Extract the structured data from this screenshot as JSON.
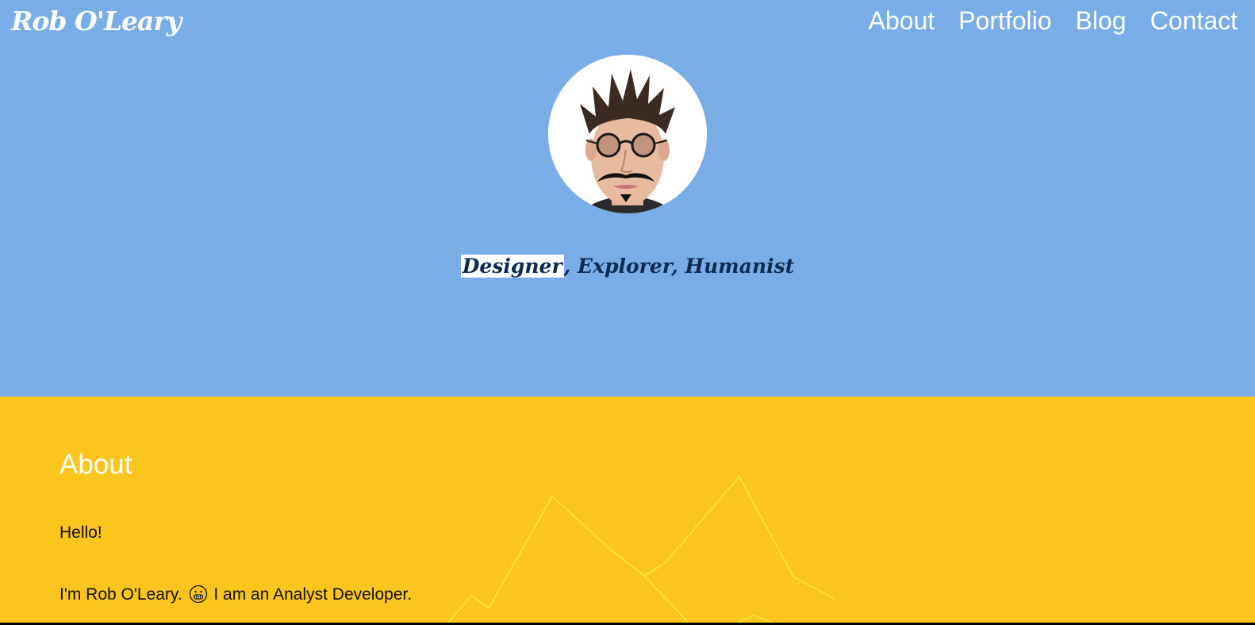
{
  "header": {
    "logo": "Rob O'Leary",
    "nav": [
      "About",
      "Portfolio",
      "Blog",
      "Contact"
    ]
  },
  "hero": {
    "avatar_alt": "Rob O'Leary portrait",
    "tagline": {
      "highlighted": "Designer",
      "rest": ", Explorer, Humanist"
    }
  },
  "about": {
    "heading": "About",
    "greeting": "Hello!",
    "intro_before": "I'm Rob O'Leary.",
    "emoji_icon": "grinning-face-icon",
    "intro_after": "I am an Analyst Developer."
  },
  "colors": {
    "hero_bg": "#79ade7",
    "about_bg": "#fbc51d",
    "tagline": "#0d2b52",
    "mountain_line": "#ffe23b"
  }
}
